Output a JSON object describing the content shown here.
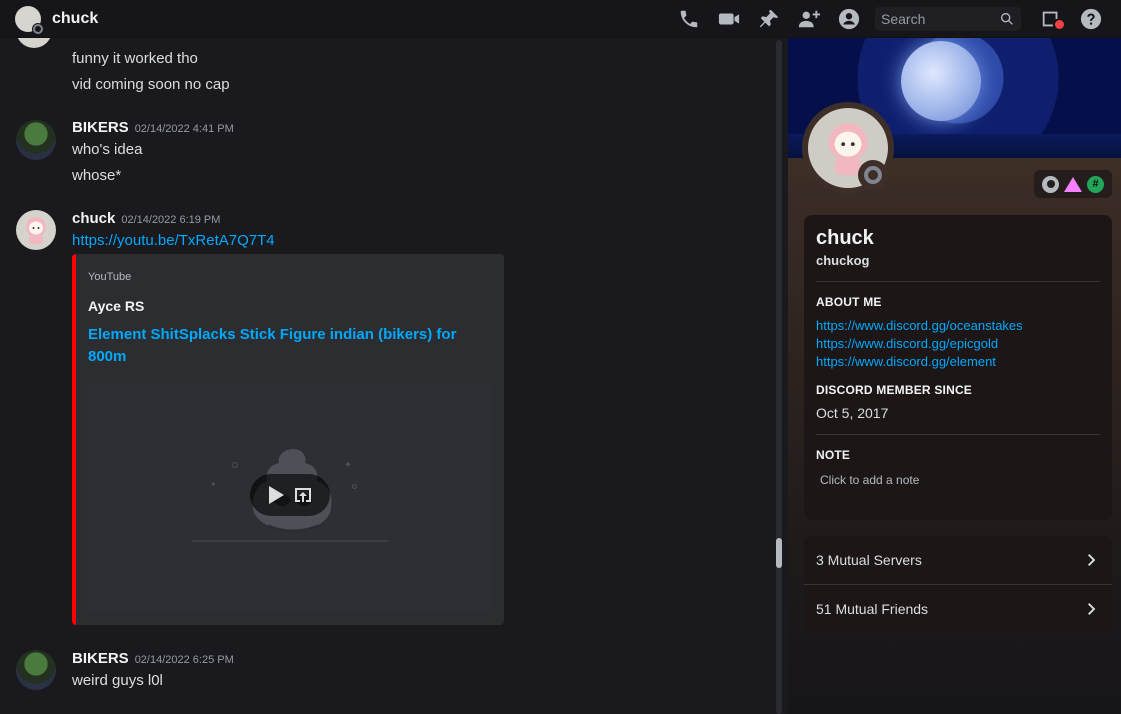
{
  "header": {
    "title": "chuck",
    "search_placeholder": "Search"
  },
  "messages": {
    "cont_line1": "funny it worked tho",
    "cont_line2": "vid coming soon no cap",
    "m1": {
      "author": "BIKERS",
      "time": "02/14/2022 4:41 PM",
      "line1": "who's idea",
      "line2": "whose*"
    },
    "m2": {
      "author": "chuck",
      "time": "02/14/2022 6:19 PM",
      "link": "https://youtu.be/TxRetA7Q7T4",
      "embed": {
        "provider": "YouTube",
        "author": "Ayce RS",
        "title": "Element ShitSplacks Stick Figure indian (bikers) for 800m",
        "accent": "#ff0000"
      }
    },
    "m3": {
      "author": "BIKERS",
      "time": "02/14/2022 6:25 PM",
      "line1": "weird guys l0l"
    }
  },
  "profile": {
    "display_name": "chuck",
    "username": "chuckog",
    "about_heading": "ABOUT ME",
    "about_links": [
      "https://www.discord.gg/oceanstakes",
      "https://www.discord.gg/epicgold",
      "https://www.discord.gg/element"
    ],
    "member_since_heading": "DISCORD MEMBER SINCE",
    "member_since": "Oct 5, 2017",
    "note_heading": "NOTE",
    "note_placeholder": "Click to add a note",
    "badge_hash": "#",
    "mutual_servers": "3 Mutual Servers",
    "mutual_friends": "51 Mutual Friends"
  },
  "colors": {
    "link": "#00a8fc",
    "embed_accent": "#ff0000",
    "hypesquad_badge": "#f47fff",
    "green_badge": "#23a55a"
  }
}
